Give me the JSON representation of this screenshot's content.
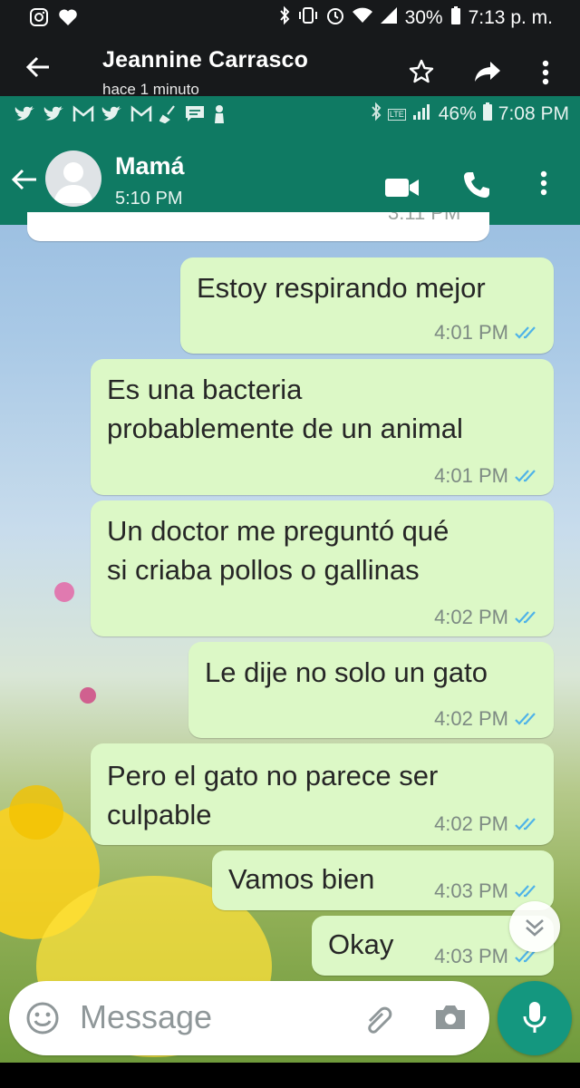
{
  "outer_status": {
    "battery": "30%",
    "time": "7:13 p. m."
  },
  "viewer": {
    "contact_name": "Jeannine Carrasco",
    "subtitle": "hace 1 minuto"
  },
  "inner_status": {
    "battery": "46%",
    "time": "7:08 PM",
    "network": "LTE"
  },
  "chat": {
    "contact_name": "Mamá",
    "last_seen": "5:10 PM",
    "messages": [
      {
        "text_lines": [
          "Estoy respirando mejor"
        ],
        "time": "4:01 PM"
      },
      {
        "text_lines": [
          "Es una bacteria",
          "probablemente de un animal"
        ],
        "time": "4:01 PM"
      },
      {
        "text_lines": [
          "Un doctor me preguntó qué",
          "si criaba pollos o gallinas"
        ],
        "time": "4:02 PM"
      },
      {
        "text_lines": [
          "Le dije no solo un gato"
        ],
        "time": "4:02 PM"
      },
      {
        "text_lines": [
          "Pero el gato no parece ser",
          "culpable"
        ],
        "time": "4:02 PM"
      },
      {
        "text_lines": [
          "Vamos bien"
        ],
        "time": "4:03 PM"
      },
      {
        "text_lines": [
          "Okay"
        ],
        "time": "4:03 PM"
      }
    ],
    "partial_time": "3:11 PM"
  },
  "composer": {
    "placeholder": "Message"
  },
  "colors": {
    "header": "#0f7a63",
    "bubble": "#dcf8c6",
    "ticks": "#4fb3e8",
    "mic": "#14977f"
  }
}
